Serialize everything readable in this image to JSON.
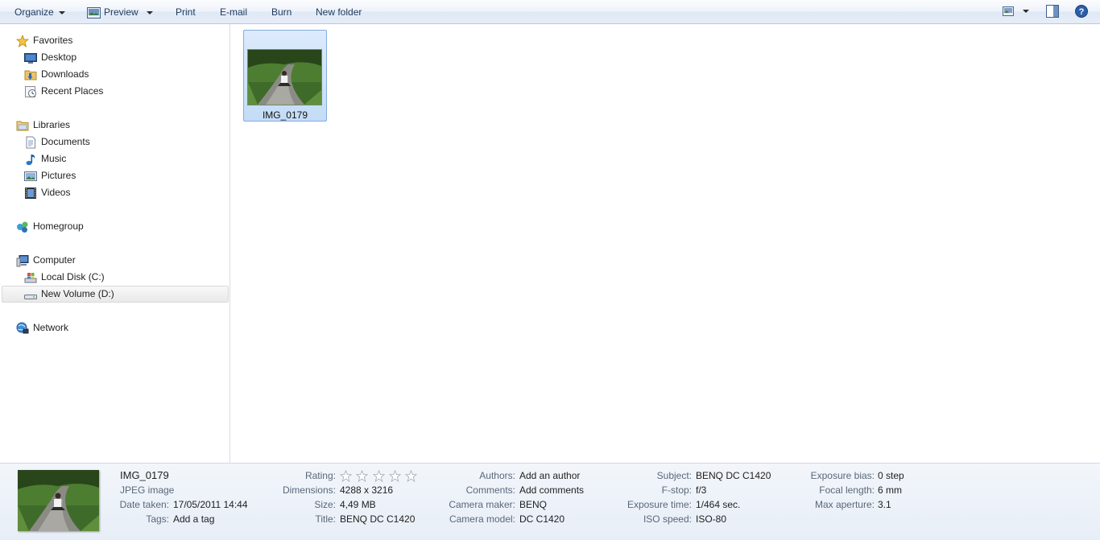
{
  "toolbar": {
    "organize": "Organize",
    "preview": "Preview",
    "print": "Print",
    "email": "E-mail",
    "burn": "Burn",
    "new_folder": "New folder"
  },
  "nav": {
    "favorites": "Favorites",
    "desktop": "Desktop",
    "downloads": "Downloads",
    "recent_places": "Recent Places",
    "libraries": "Libraries",
    "documents": "Documents",
    "music": "Music",
    "pictures": "Pictures",
    "videos": "Videos",
    "homegroup": "Homegroup",
    "computer": "Computer",
    "local_disk": "Local Disk (C:)",
    "new_volume": "New Volume (D:)",
    "network": "Network"
  },
  "content": {
    "file_name": "IMG_0179"
  },
  "details": {
    "name": "IMG_0179",
    "type": "JPEG image",
    "date_taken_label": "Date taken:",
    "date_taken": "17/05/2011 14:44",
    "tags_label": "Tags:",
    "tags": "Add a tag",
    "rating_label": "Rating:",
    "rating_value": 0,
    "dimensions_label": "Dimensions:",
    "dimensions": "4288 x 3216",
    "size_label": "Size:",
    "size": "4,49 MB",
    "title_label": "Title:",
    "title": "BENQ DC C1420",
    "authors_label": "Authors:",
    "authors": "Add an author",
    "comments_label": "Comments:",
    "comments": "Add comments",
    "camera_maker_label": "Camera maker:",
    "camera_maker": "BENQ",
    "camera_model_label": "Camera model:",
    "camera_model": "DC C1420",
    "subject_label": "Subject:",
    "subject": "BENQ DC C1420",
    "fstop_label": "F-stop:",
    "fstop": "f/3",
    "exposure_time_label": "Exposure time:",
    "exposure_time": "1/464 sec.",
    "iso_label": "ISO speed:",
    "iso": "ISO-80",
    "exposure_bias_label": "Exposure bias:",
    "exposure_bias": "0 step",
    "focal_length_label": "Focal length:",
    "focal_length": "6 mm",
    "max_aperture_label": "Max aperture:",
    "max_aperture": "3.1"
  },
  "colors": {
    "selection_fill": "#cce0f8",
    "selection_border": "#84acdd",
    "details_bg": "#eef3f9"
  }
}
